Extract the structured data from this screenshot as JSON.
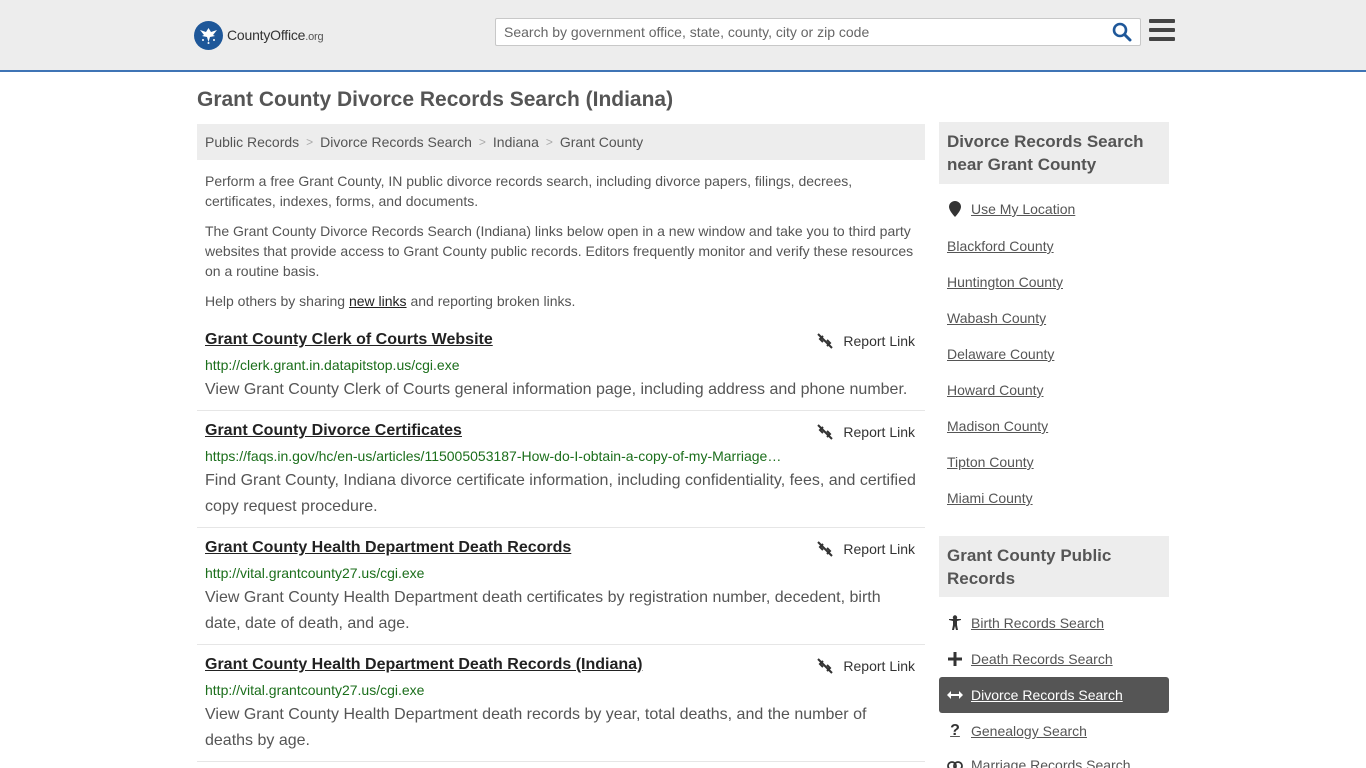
{
  "header": {
    "logo_name": "CountyOffice",
    "logo_suffix": ".org",
    "search_placeholder": "Search by government office, state, county, city or zip code"
  },
  "page_title": "Grant County Divorce Records Search (Indiana)",
  "breadcrumb": [
    "Public Records",
    "Divorce Records Search",
    "Indiana",
    "Grant County"
  ],
  "intro": {
    "p1": "Perform a free Grant County, IN public divorce records search, including divorce papers, filings, decrees, certificates, indexes, forms, and documents.",
    "p2": "The Grant County Divorce Records Search (Indiana) links below open in a new window and take you to third party websites that provide access to Grant County public records. Editors frequently monitor and verify these resources on a routine basis.",
    "p3_before": "Help others by sharing ",
    "p3_link": "new links",
    "p3_after": " and reporting broken links."
  },
  "report_label": "Report Link",
  "results": [
    {
      "title": "Grant County Clerk of Courts Website",
      "url": "http://clerk.grant.in.datapitstop.us/cgi.exe",
      "desc": "View Grant County Clerk of Courts general information page, including address and phone number."
    },
    {
      "title": "Grant County Divorce Certificates",
      "url": "https://faqs.in.gov/hc/en-us/articles/115005053187-How-do-I-obtain-a-copy-of-my-Marriage…",
      "desc": "Find Grant County, Indiana divorce certificate information, including confidentiality, fees, and certified copy request procedure."
    },
    {
      "title": "Grant County Health Department Death Records",
      "url": "http://vital.grantcounty27.us/cgi.exe",
      "desc": "View Grant County Health Department death certificates by registration number, decedent, birth date, date of death, and age."
    },
    {
      "title": "Grant County Health Department Death Records (Indiana)",
      "url": "http://vital.grantcounty27.us/cgi.exe",
      "desc": "View Grant County Health Department death records by year, total deaths, and the number of deaths by age."
    }
  ],
  "sidebar": {
    "nearby_heading": "Divorce Records Search near Grant County",
    "use_location": "Use My Location",
    "nearby": [
      "Blackford County",
      "Huntington County",
      "Wabash County",
      "Delaware County",
      "Howard County",
      "Madison County",
      "Tipton County",
      "Miami County"
    ],
    "public_heading": "Grant County Public Records",
    "public_links": [
      {
        "label": "Birth Records Search",
        "icon": "child-icon"
      },
      {
        "label": "Death Records Search",
        "icon": "cross-icon"
      },
      {
        "label": "Divorce Records Search",
        "icon": "arrows-icon"
      },
      {
        "label": "Genealogy Search",
        "icon": "question-icon"
      },
      {
        "label": "Marriage Records Search",
        "icon": "rings-icon"
      }
    ]
  },
  "colors": {
    "link_green": "#1b6e1b",
    "header_bg": "#ededed",
    "header_border": "#3f74b5",
    "logo_blue": "#1e5799",
    "active_bg": "#555555"
  }
}
